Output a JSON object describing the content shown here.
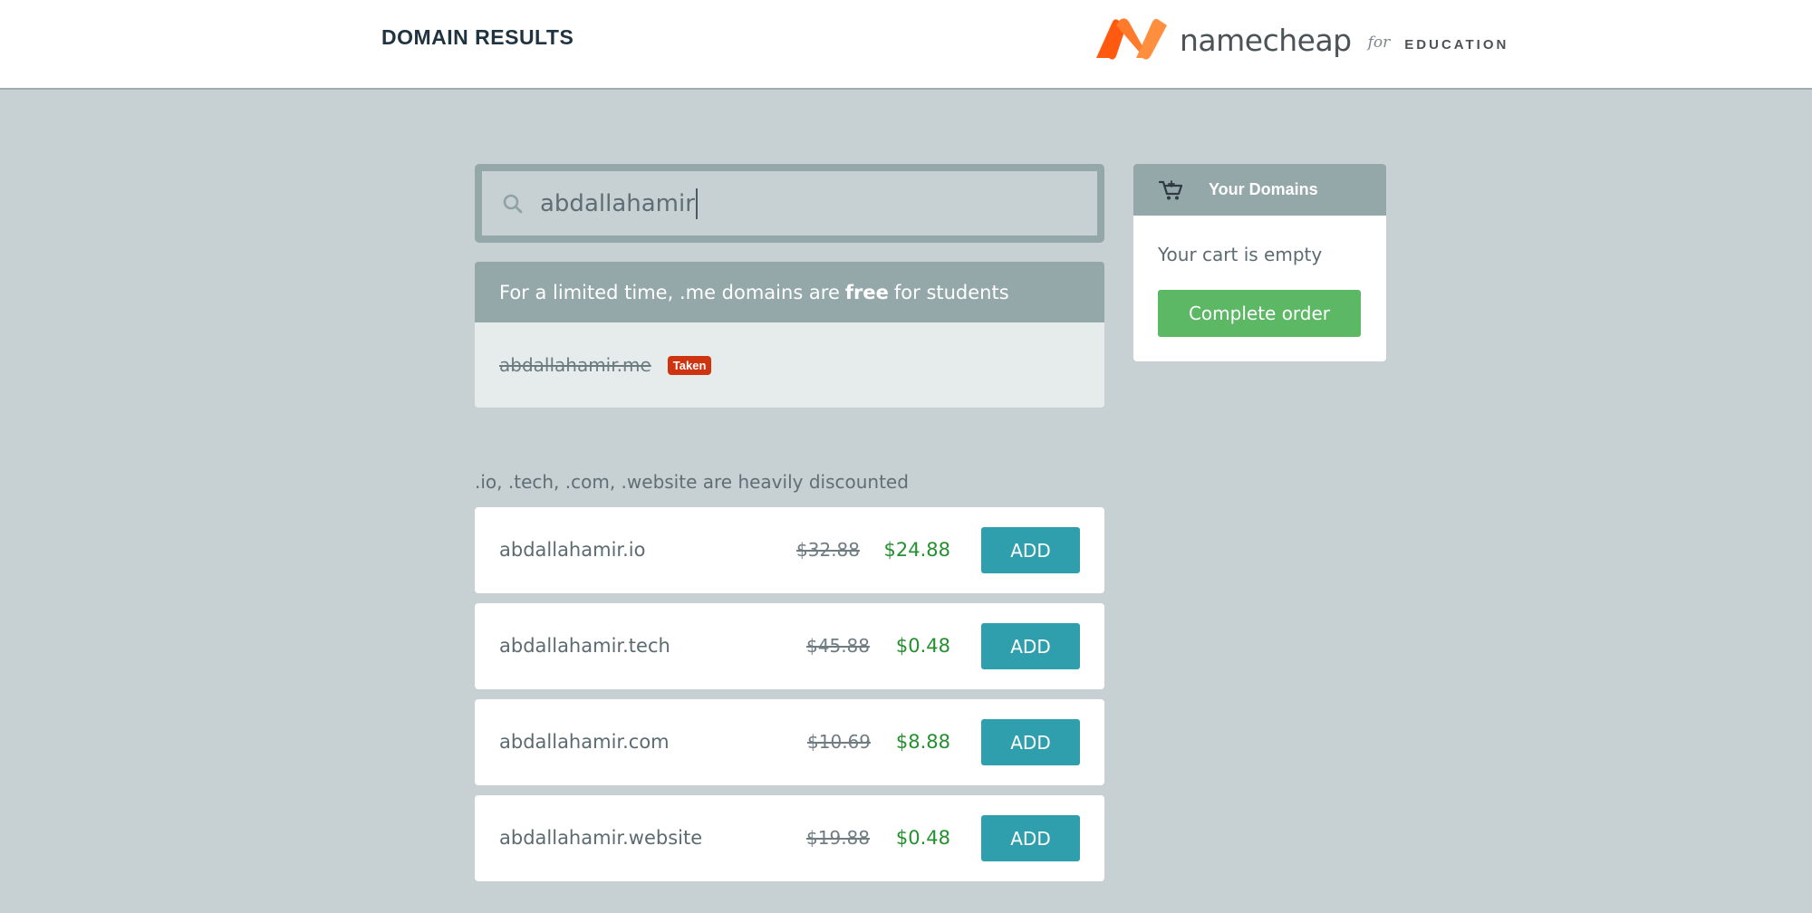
{
  "header": {
    "title": "DOMAIN RESULTS",
    "brand": {
      "name": "namecheap",
      "for": "for",
      "program": "EDUCATION"
    },
    "colors": {
      "logo_orange": "#ff6a14",
      "logo_orange_light": "#ff8f3f"
    }
  },
  "search": {
    "value": "abdallahamir",
    "icon": "search-icon"
  },
  "promo": {
    "text_before": "For a limited time, .me domains are",
    "text_bold": "free",
    "text_after": "for students",
    "result": {
      "domain": "abdallahamir.me",
      "status": "Taken"
    }
  },
  "discount": {
    "label": ".io, .tech, .com, .website are heavily discounted",
    "items": [
      {
        "domain": "abdallahamir.io",
        "old_price": "$32.88",
        "new_price": "$24.88",
        "action": "ADD"
      },
      {
        "domain": "abdallahamir.tech",
        "old_price": "$45.88",
        "new_price": "$0.48",
        "action": "ADD"
      },
      {
        "domain": "abdallahamir.com",
        "old_price": "$10.69",
        "new_price": "$8.88",
        "action": "ADD"
      },
      {
        "domain": "abdallahamir.website",
        "old_price": "$19.88",
        "new_price": "$0.48",
        "action": "ADD"
      }
    ]
  },
  "cart": {
    "title": "Your Domains",
    "icon": "cart-icon",
    "empty_text": "Your cart is empty",
    "button": "Complete order"
  }
}
